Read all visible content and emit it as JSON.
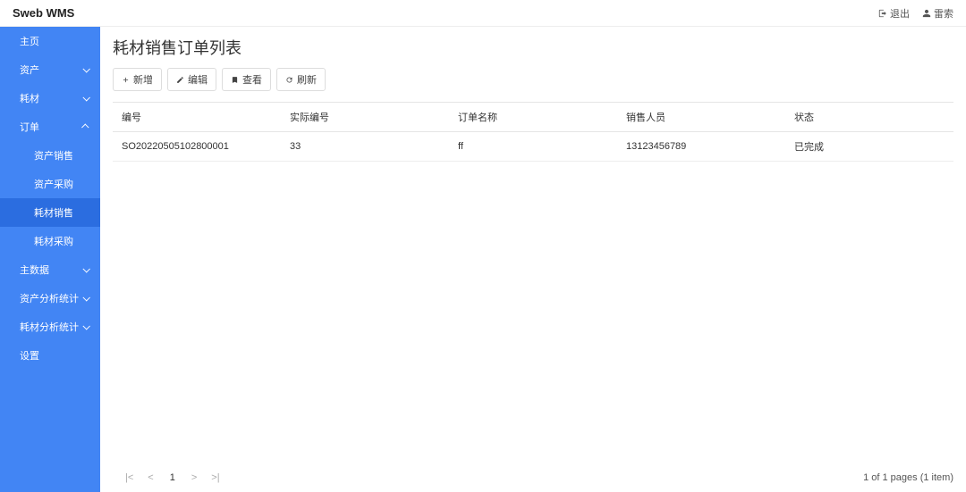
{
  "header": {
    "brand": "Sweb WMS",
    "logout": "退出",
    "user": "雷索"
  },
  "sidebar": {
    "items": [
      {
        "label": "主页",
        "expandable": false
      },
      {
        "label": "资产",
        "expandable": true,
        "chevron": "down"
      },
      {
        "label": "耗材",
        "expandable": true,
        "chevron": "down"
      },
      {
        "label": "订单",
        "expandable": true,
        "chevron": "up"
      },
      {
        "label": "资产销售",
        "sub": true
      },
      {
        "label": "资产采购",
        "sub": true
      },
      {
        "label": "耗材销售",
        "sub": true,
        "active": true
      },
      {
        "label": "耗材采购",
        "sub": true
      },
      {
        "label": "主数据",
        "expandable": true,
        "chevron": "down"
      },
      {
        "label": "资产分析统计",
        "expandable": true,
        "chevron": "down"
      },
      {
        "label": "耗材分析统计",
        "expandable": true,
        "chevron": "down"
      },
      {
        "label": "设置",
        "expandable": false
      }
    ]
  },
  "main": {
    "title": "耗材销售订单列表",
    "toolbar": {
      "add": "新增",
      "edit": "编辑",
      "view": "查看",
      "refresh": "刷新"
    },
    "table": {
      "columns": [
        "编号",
        "实际编号",
        "订单名称",
        "销售人员",
        "状态"
      ],
      "rows": [
        [
          "SO20220505102800001",
          "33",
          "ff",
          "13123456789",
          "已完成"
        ]
      ]
    },
    "pagination": {
      "current": "1",
      "info": "1 of 1 pages (1 item)"
    }
  }
}
